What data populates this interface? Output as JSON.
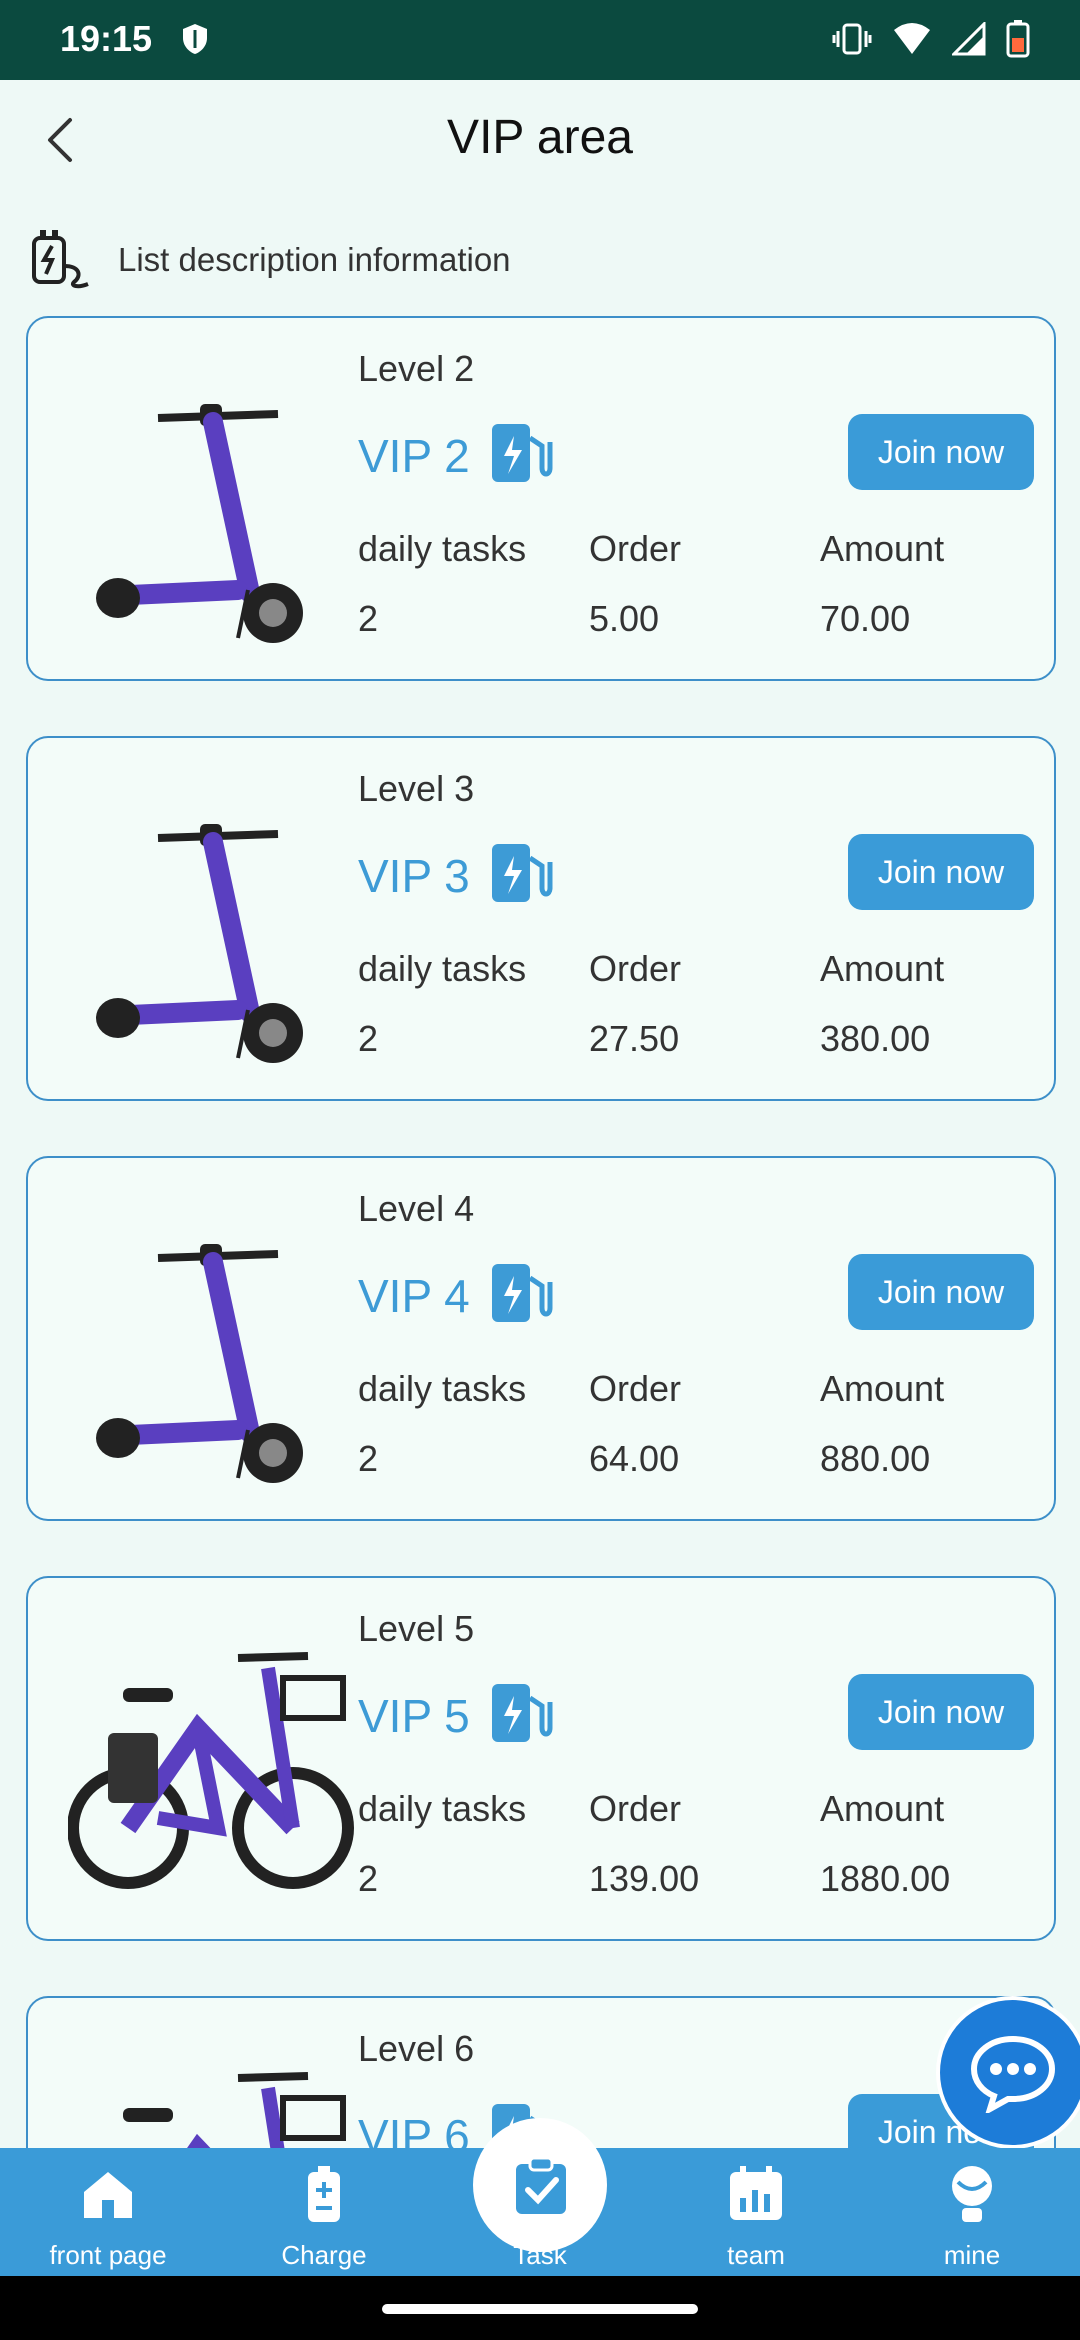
{
  "status_bar": {
    "time": "19:15"
  },
  "header": {
    "title": "VIP area"
  },
  "list_description": "List description information",
  "labels": {
    "daily_tasks": "daily tasks",
    "order": "Order",
    "amount": "Amount",
    "join": "Join now"
  },
  "cards": [
    {
      "level": "Level 2",
      "vip": "VIP 2",
      "daily_tasks": "2",
      "order": "5.00",
      "amount": "70.00",
      "vehicle": "scooter"
    },
    {
      "level": "Level 3",
      "vip": "VIP 3",
      "daily_tasks": "2",
      "order": "27.50",
      "amount": "380.00",
      "vehicle": "scooter"
    },
    {
      "level": "Level 4",
      "vip": "VIP 4",
      "daily_tasks": "2",
      "order": "64.00",
      "amount": "880.00",
      "vehicle": "scooter"
    },
    {
      "level": "Level 5",
      "vip": "VIP 5",
      "daily_tasks": "2",
      "order": "139.00",
      "amount": "1880.00",
      "vehicle": "ebike"
    },
    {
      "level": "Level 6",
      "vip": "VIP 6",
      "vehicle": "ebike"
    }
  ],
  "nav": [
    {
      "label": "front page",
      "icon": "home-icon"
    },
    {
      "label": "Charge",
      "icon": "battery-icon"
    },
    {
      "label": "Task",
      "icon": "task-clipboard-icon"
    },
    {
      "label": "team",
      "icon": "team-calendar-icon"
    },
    {
      "label": "mine",
      "icon": "user-icon"
    }
  ],
  "colors": {
    "accent": "#3a9bd8",
    "status_bar": "#0b4a3f",
    "background": "#eef9f6",
    "vip_text": "#3d9bd6"
  }
}
